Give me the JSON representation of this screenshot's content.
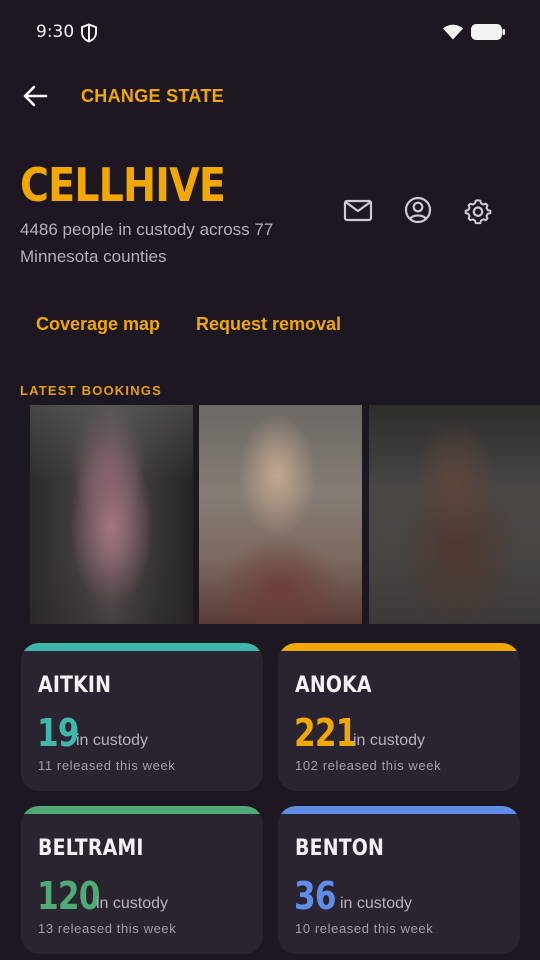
{
  "status_bar": {
    "time": "9:30"
  },
  "topbar": {
    "action_label": "CHANGE STATE"
  },
  "brand": {
    "title": "CELLHIVE",
    "subtitle": "4486 people in custody across 77 Minnesota counties"
  },
  "links": {
    "coverage": "Coverage map",
    "removal": "Request removal"
  },
  "latest": {
    "label": "LATEST BOOKINGS"
  },
  "colors": {
    "accent": "#f2a800",
    "background": "#1d1722",
    "card": "#2a2330",
    "aitkin": "#3fb8ac",
    "anoka": "#f2a800",
    "beltrami": "#4faa75",
    "benton": "#5f8ee8"
  },
  "counties": [
    {
      "name": "AITKIN",
      "count": "19",
      "custody_label": "in custody",
      "released": "11 released this week"
    },
    {
      "name": "ANOKA",
      "count": "221",
      "custody_label": "in custody",
      "released": "102 released this week"
    },
    {
      "name": "BELTRAMI",
      "count": "120",
      "custody_label": "in custody",
      "released": "13 released this week"
    },
    {
      "name": "BENTON",
      "count": "36",
      "custody_label": "in custody",
      "released": "10 released this week"
    }
  ],
  "icons": [
    "shield-icon",
    "wifi-icon",
    "battery-icon",
    "arrow-back-icon",
    "mail-icon",
    "account-icon",
    "settings-icon"
  ]
}
